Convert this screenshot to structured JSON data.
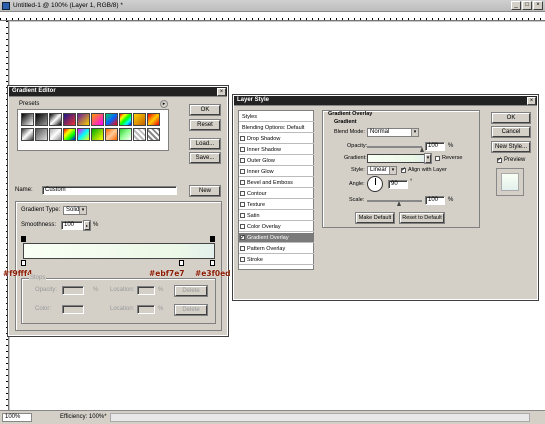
{
  "app": {
    "doc_title": "Untitled-1 @ 100% (Layer 1, RGB/8) *",
    "win_min": "_",
    "win_max": "□",
    "win_close": "×"
  },
  "status": {
    "zoom": "100%",
    "efficiency": "Efficiency: 100%*"
  },
  "gradient_editor": {
    "title": "Gradient Editor",
    "close": "×",
    "presets_label": "Presets",
    "presets_arrow": "▸",
    "ok": "OK",
    "reset": "Reset",
    "load": "Load...",
    "save": "Save...",
    "name_label": "Name:",
    "name_value": "Custom",
    "new": "New",
    "gradient_type_label": "Gradient Type:",
    "gradient_type_value": "Solid",
    "smoothness_label": "Smoothness:",
    "smoothness_value": "100",
    "smoothness_unit": "%",
    "stops_legend": "Stops",
    "opacity_label": "Opacity:",
    "opacity_unit": "%",
    "location_label": "Location:",
    "location_unit": "%",
    "color_label": "Color:",
    "delete": "Delete",
    "color_tags": [
      "#f9fff4",
      "#ebf7e7",
      "#e3f0ed"
    ],
    "gradient_start": "#f9fff4",
    "gradient_mid": "#ebf7e7",
    "gradient_end": "#e3f0ed"
  },
  "layer_style": {
    "title": "Layer Style",
    "close": "×",
    "list": [
      {
        "label": "Styles",
        "check": false,
        "on": false,
        "sel": false
      },
      {
        "label": "Blending Options: Default",
        "check": false,
        "on": false,
        "sel": false
      },
      {
        "label": "Drop Shadow",
        "check": true,
        "on": false,
        "sel": false
      },
      {
        "label": "Inner Shadow",
        "check": true,
        "on": false,
        "sel": false
      },
      {
        "label": "Outer Glow",
        "check": true,
        "on": false,
        "sel": false
      },
      {
        "label": "Inner Glow",
        "check": true,
        "on": false,
        "sel": false
      },
      {
        "label": "Bevel and Emboss",
        "check": true,
        "on": false,
        "sel": false
      },
      {
        "label": "Contour",
        "check": true,
        "on": false,
        "sel": false
      },
      {
        "label": "Texture",
        "check": true,
        "on": false,
        "sel": false
      },
      {
        "label": "Satin",
        "check": true,
        "on": false,
        "sel": false
      },
      {
        "label": "Color Overlay",
        "check": true,
        "on": false,
        "sel": false
      },
      {
        "label": "Gradient Overlay",
        "check": true,
        "on": true,
        "sel": true
      },
      {
        "label": "Pattern Overlay",
        "check": true,
        "on": false,
        "sel": false
      },
      {
        "label": "Stroke",
        "check": true,
        "on": false,
        "sel": false
      }
    ],
    "section_title": "Gradient Overlay",
    "section_sub": "Gradient",
    "blend_label": "Blend Mode:",
    "blend_value": "Normal",
    "opacity_label": "Opacity:",
    "opacity_value": "100",
    "opacity_unit": "%",
    "gradient_label": "Gradient:",
    "reverse_label": "Reverse",
    "style_label": "Style:",
    "style_value": "Linear",
    "align_label": "Align with Layer",
    "angle_label": "Angle:",
    "angle_value": "90",
    "angle_unit": "°",
    "scale_label": "Scale:",
    "scale_value": "100",
    "scale_unit": "%",
    "make_default": "Make Default",
    "reset_default": "Reset to Default",
    "ok": "OK",
    "cancel": "Cancel",
    "new_style": "New Style...",
    "preview_label": "Preview"
  }
}
